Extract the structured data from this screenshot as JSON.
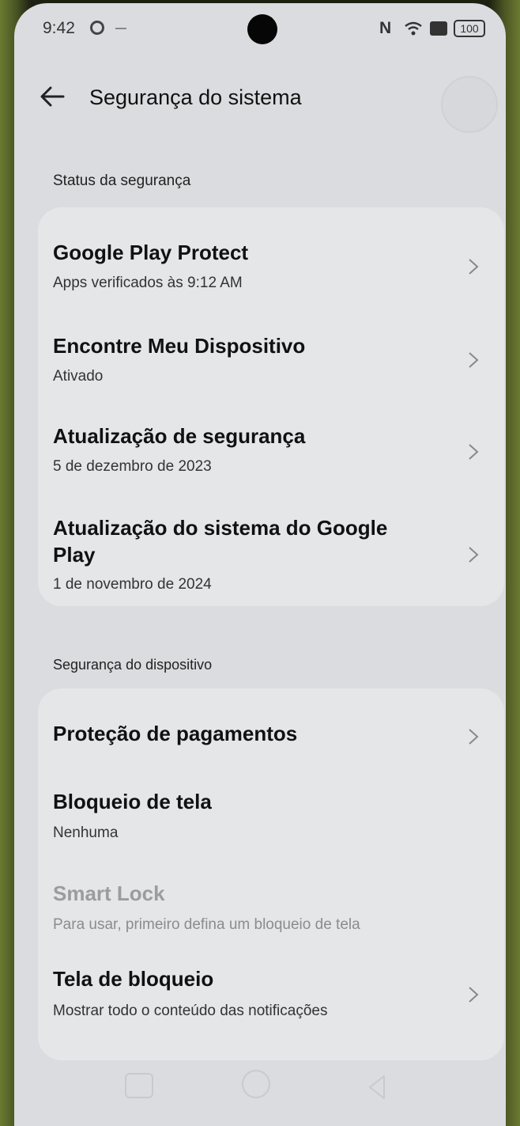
{
  "status_bar": {
    "time": "9:42",
    "nfc": "N",
    "battery": "100"
  },
  "header": {
    "title": "Segurança do sistema"
  },
  "sections": {
    "security_status": "Status da segurança",
    "device_security": "Segurança do dispositivo"
  },
  "status_items": [
    {
      "title": "Google Play Protect",
      "subtitle": "Apps verificados às 9:12 AM"
    },
    {
      "title": "Encontre Meu Dispositivo",
      "subtitle": "Ativado"
    },
    {
      "title": "Atualização de segurança",
      "subtitle": "5 de dezembro de 2023"
    },
    {
      "title_line1": "Atualização do sistema do Google",
      "title_line2": "Play",
      "subtitle": "1 de novembro de 2024"
    }
  ],
  "device_items": [
    {
      "title": "Proteção de pagamentos"
    },
    {
      "title": "Bloqueio de tela",
      "subtitle": "Nenhuma"
    },
    {
      "title": "Smart Lock",
      "subtitle": "Para usar, primeiro defina um bloqueio de tela"
    },
    {
      "title": "Tela de bloqueio",
      "subtitle": "Mostrar todo o conteúdo das notificações"
    }
  ]
}
